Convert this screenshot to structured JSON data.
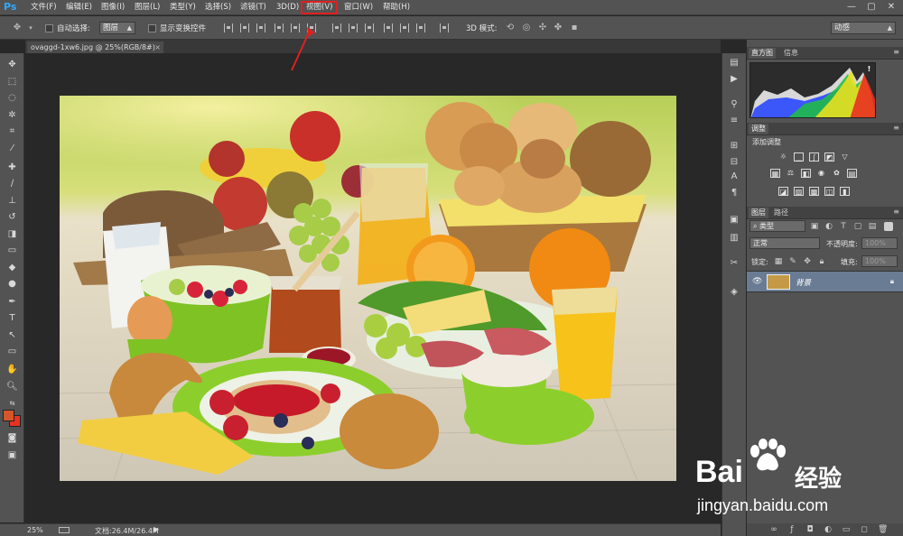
{
  "app": {
    "logo": "Ps"
  },
  "menubar": {
    "items": [
      {
        "label": "文件(F)"
      },
      {
        "label": "编辑(E)"
      },
      {
        "label": "图像(I)"
      },
      {
        "label": "图层(L)"
      },
      {
        "label": "类型(Y)"
      },
      {
        "label": "选择(S)"
      },
      {
        "label": "滤镜(T)"
      },
      {
        "label": "3D(D)"
      },
      {
        "label": "视图(V)"
      },
      {
        "label": "窗口(W)"
      },
      {
        "label": "帮助(H)"
      }
    ],
    "highlighted": "视图(V)",
    "highlight_color": "#e02020",
    "window_controls": {
      "minimize": "—",
      "restore": "▢",
      "close": "✕"
    }
  },
  "options_bar": {
    "auto_select_label": "自动选择:",
    "auto_select_value": "图层",
    "show_transform_label": "显示变换控件",
    "mode_3d_label": "3D 模式:",
    "workspace_value": "动感"
  },
  "document": {
    "tab_title": "ovaggd-1xw6.jpg @ 25%(RGB/8#)",
    "close": "×"
  },
  "status": {
    "zoom": "25%",
    "doc_size": "文档:26.4M/26.4M"
  },
  "panels": {
    "histogram": {
      "tabs": [
        "直方图",
        "信息"
      ],
      "warning_icon": "!"
    },
    "adjustments": {
      "tab": "调整",
      "heading": "添加调整"
    },
    "layers": {
      "tabs": [
        "图层",
        "路径"
      ],
      "filter_kind": "类型",
      "blend_mode": "正常",
      "opacity_label": "不透明度:",
      "opacity_value": "100%",
      "lock_label": "锁定:",
      "fill_label": "填充:",
      "fill_value": "100%",
      "layer_name": "背景"
    }
  },
  "watermark": {
    "brand": "Bai",
    "brand_cn": "经验",
    "url": "jingyan.baidu.com"
  },
  "colors": {
    "foreground": "#d4562a",
    "background": "#e83222",
    "annotation_arrow": "#e02020"
  }
}
